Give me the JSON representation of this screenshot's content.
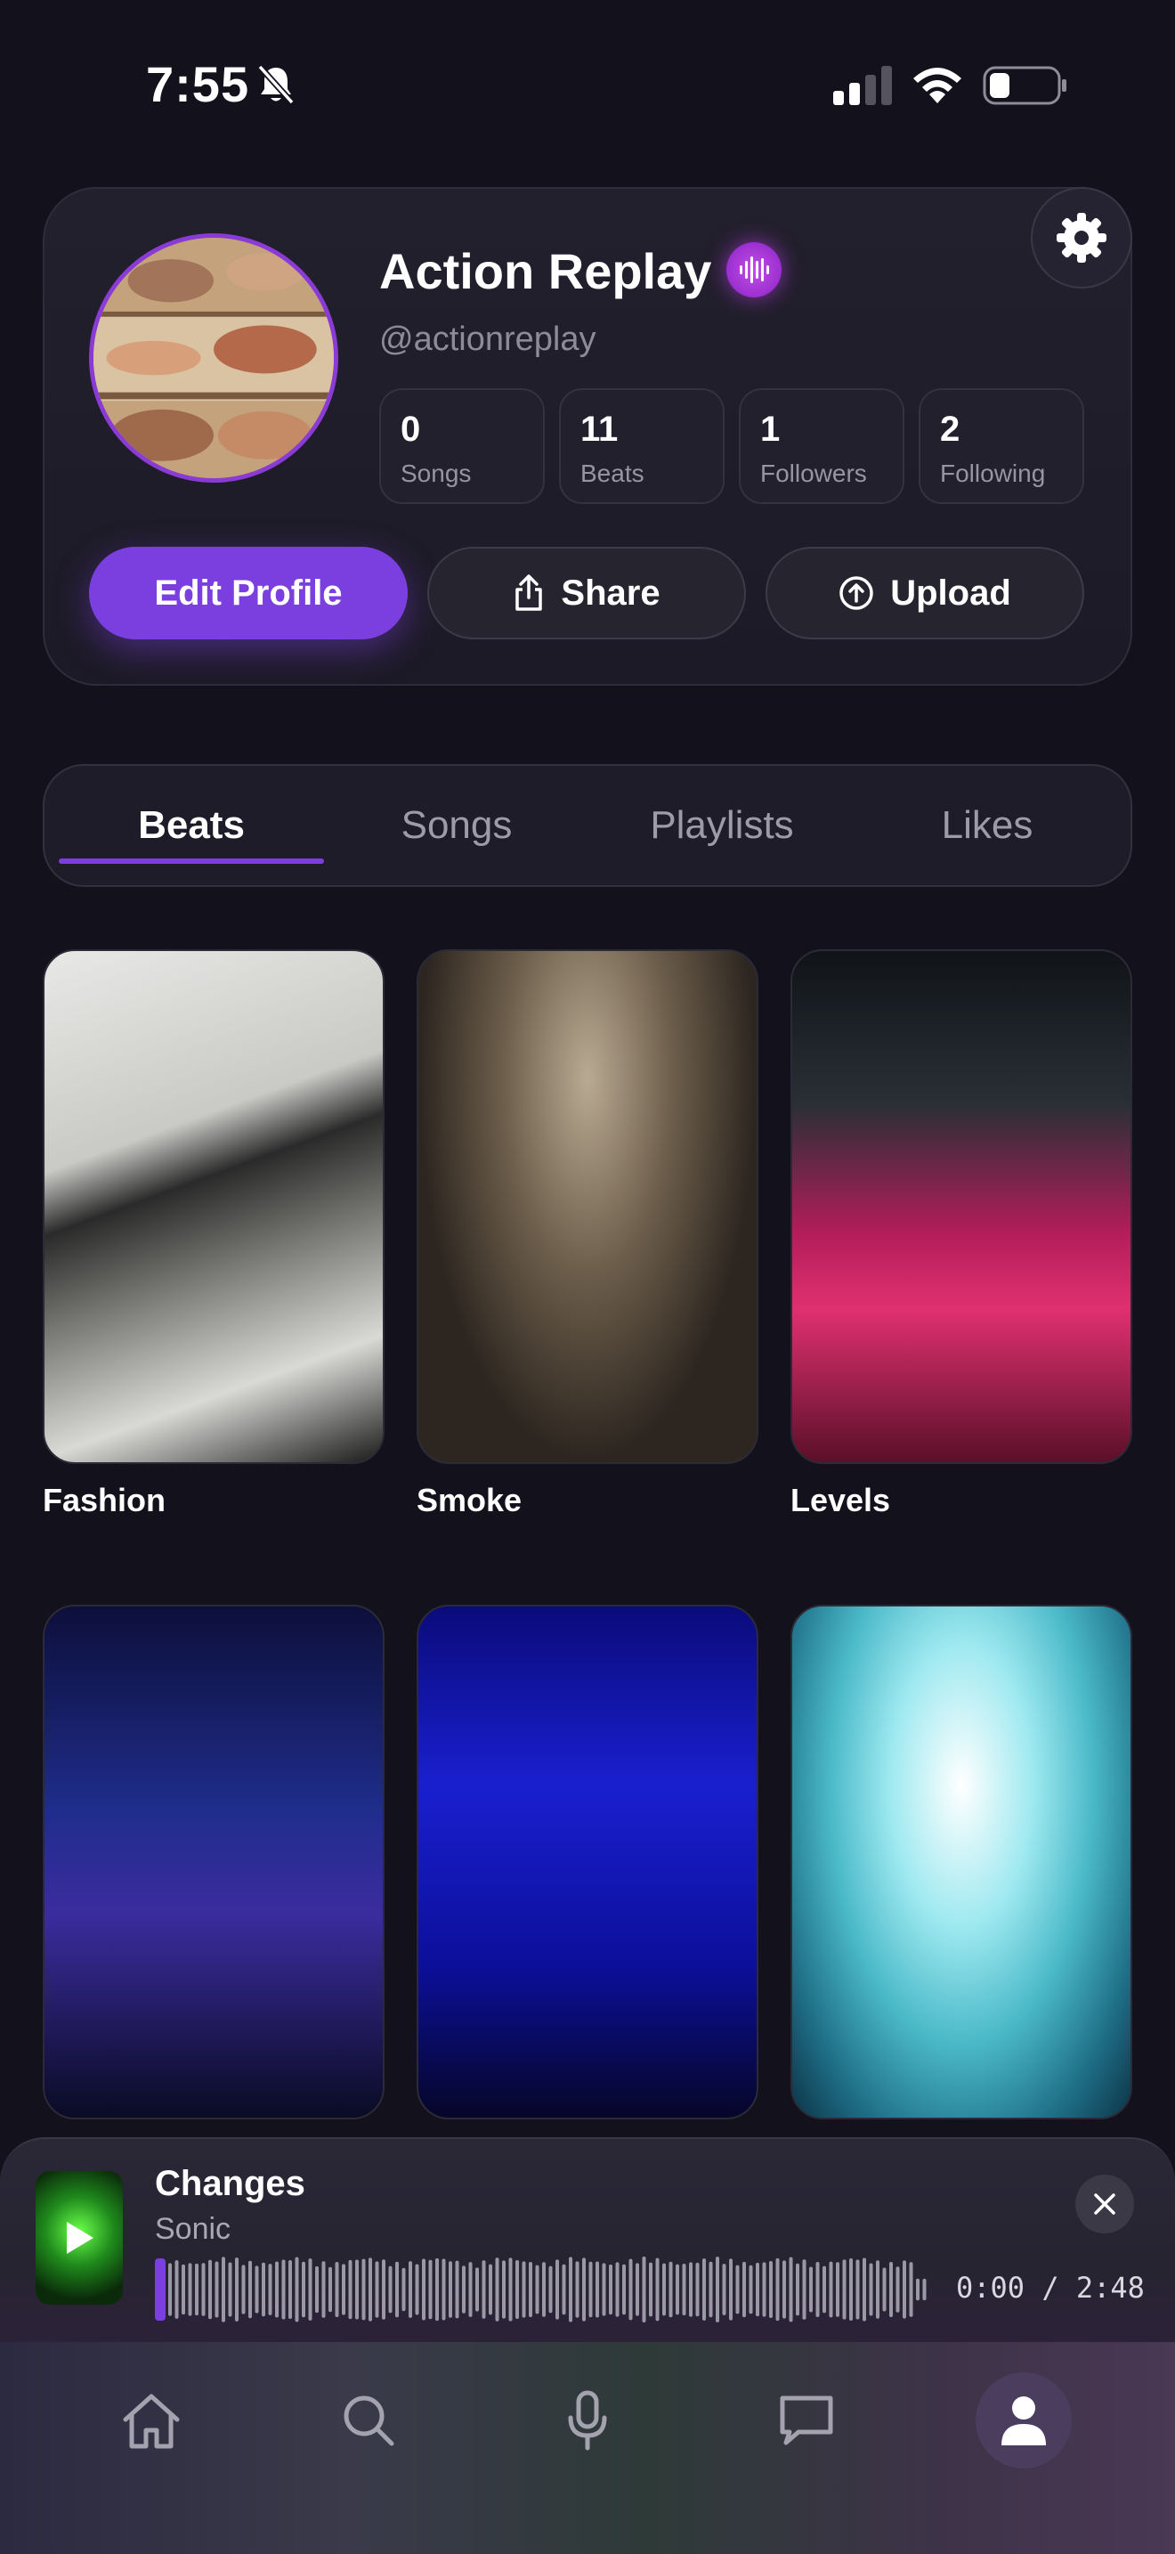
{
  "status_bar": {
    "time": "7:55"
  },
  "profile": {
    "name": "Action Replay",
    "handle": "@actionreplay",
    "stats": [
      {
        "value": "0",
        "label": "Songs"
      },
      {
        "value": "11",
        "label": "Beats"
      },
      {
        "value": "1",
        "label": "Followers"
      },
      {
        "value": "2",
        "label": "Following"
      }
    ],
    "buttons": {
      "edit": "Edit Profile",
      "share": "Share",
      "upload": "Upload"
    }
  },
  "tabs": [
    {
      "label": "Beats",
      "active": true
    },
    {
      "label": "Songs",
      "active": false
    },
    {
      "label": "Playlists",
      "active": false
    },
    {
      "label": "Likes",
      "active": false
    }
  ],
  "beats": [
    {
      "title": "Fashion"
    },
    {
      "title": "Smoke"
    },
    {
      "title": "Levels"
    },
    {
      "title": ""
    },
    {
      "title": ""
    },
    {
      "title": ""
    }
  ],
  "player": {
    "title": "Changes",
    "artist": "Sonic",
    "time": "0:00 / 2:48",
    "progress": 0
  },
  "nav": [
    "home-icon",
    "search-icon",
    "microphone-icon",
    "chat-icon",
    "profile-icon"
  ],
  "colors": {
    "accent": "#7b3fe0",
    "badge": "#b53fe0",
    "background": "#12111c"
  }
}
